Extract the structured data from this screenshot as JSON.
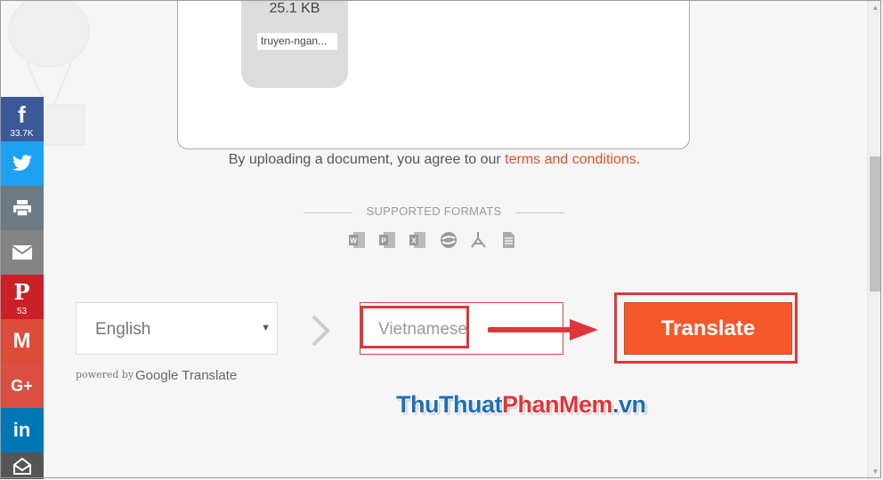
{
  "upload": {
    "file_size": "25.1 KB",
    "file_name": "truyen-ngan..."
  },
  "terms": {
    "prefix": "By uploading a document, you agree to our ",
    "link": "terms and conditions",
    "suffix": "."
  },
  "formats": {
    "title": "SUPPORTED FORMATS",
    "icons": [
      "word-icon",
      "powerpoint-icon",
      "excel-icon",
      "opendocument-icon",
      "pdf-icon",
      "text-file-icon"
    ]
  },
  "social": [
    {
      "name": "facebook",
      "glyph": "f",
      "count": "33.7K",
      "color": "#3b5998"
    },
    {
      "name": "twitter",
      "glyph": "",
      "count": "",
      "color": "#1da1f2"
    },
    {
      "name": "print",
      "glyph": "",
      "count": "",
      "color": "#6d7a82"
    },
    {
      "name": "email",
      "glyph": "",
      "count": "",
      "color": "#848484"
    },
    {
      "name": "pinterest",
      "glyph": "P",
      "count": "53",
      "color": "#cb2027"
    },
    {
      "name": "gmail",
      "glyph": "M",
      "count": "",
      "color": "#dd4b39"
    },
    {
      "name": "google-plus",
      "glyph": "G+",
      "count": "",
      "color": "#dc4e41"
    },
    {
      "name": "linkedin",
      "glyph": "in",
      "count": "",
      "color": "#0077b5"
    },
    {
      "name": "more",
      "glyph": "",
      "count": "",
      "color": "#555"
    }
  ],
  "translate": {
    "source_language": "English",
    "target_language": "Vietnamese",
    "button_label": "Translate",
    "powered_by": "powered by",
    "provider": "Google Translate"
  },
  "watermark": {
    "part1": "ThuThuat",
    "part2": "PhanMem",
    "part3": ".vn"
  },
  "colors": {
    "accent": "#f5592b",
    "link": "#e0502a",
    "highlight": "#e0353a"
  }
}
